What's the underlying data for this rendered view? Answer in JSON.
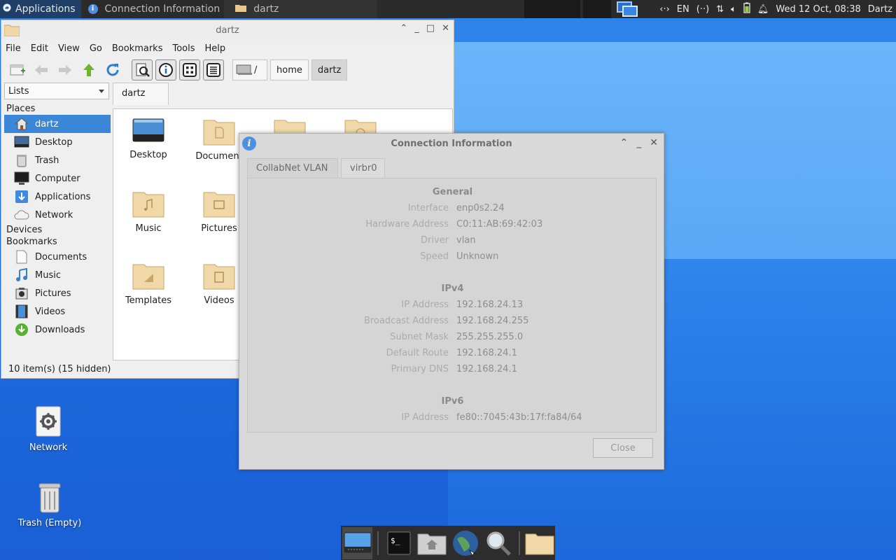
{
  "top_panel": {
    "apps_label": "Applications",
    "tasks": [
      "Connection Information",
      "dartz"
    ],
    "lang": "EN",
    "datetime": "Wed 12 Oct, 08:38",
    "user": "Dartz"
  },
  "file_manager": {
    "title": "dartz",
    "menu": [
      "File",
      "Edit",
      "View",
      "Go",
      "Bookmarks",
      "Tools",
      "Help"
    ],
    "breadcrumbs": [
      "/",
      "home",
      "dartz"
    ],
    "side_mode": "Lists",
    "tab": "dartz",
    "sidebar": {
      "places_header": "Places",
      "places": [
        "dartz",
        "Desktop",
        "Trash",
        "Computer",
        "Applications",
        "Network"
      ],
      "devices_header": "Devices",
      "bookmarks_header": "Bookmarks",
      "bookmarks": [
        "Documents",
        "Music",
        "Pictures",
        "Videos",
        "Downloads"
      ]
    },
    "files": [
      "Desktop",
      "Document",
      "Music",
      "Pictures",
      "Templates",
      "Videos"
    ],
    "status": "10 item(s) (15 hidden)"
  },
  "dialog": {
    "title": "Connection Information",
    "tabs": [
      "CollabNet VLAN",
      "virbr0"
    ],
    "general_header": "General",
    "general": [
      {
        "k": "Interface",
        "v": "enp0s2.24"
      },
      {
        "k": "Hardware Address",
        "v": "C0:11:AB:69:42:03"
      },
      {
        "k": "Driver",
        "v": "vlan"
      },
      {
        "k": "Speed",
        "v": "Unknown"
      }
    ],
    "ipv4_header": "IPv4",
    "ipv4": [
      {
        "k": "IP Address",
        "v": "192.168.24.13"
      },
      {
        "k": "Broadcast Address",
        "v": "192.168.24.255"
      },
      {
        "k": "Subnet Mask",
        "v": "255.255.255.0"
      },
      {
        "k": "Default Route",
        "v": "192.168.24.1"
      },
      {
        "k": "Primary DNS",
        "v": "192.168.24.1"
      }
    ],
    "ipv6_header": "IPv6",
    "ipv6": [
      {
        "k": "IP Address",
        "v": "fe80::7045:43b:17f:fa84/64"
      }
    ],
    "close_label": "Close"
  },
  "desktop": {
    "icons": [
      "Network",
      "Trash (Empty)"
    ]
  },
  "dock": {
    "items": [
      "desktop-icon",
      "terminal-icon",
      "home-folder-icon",
      "web-browser-icon",
      "search-icon",
      "files-icon"
    ]
  }
}
